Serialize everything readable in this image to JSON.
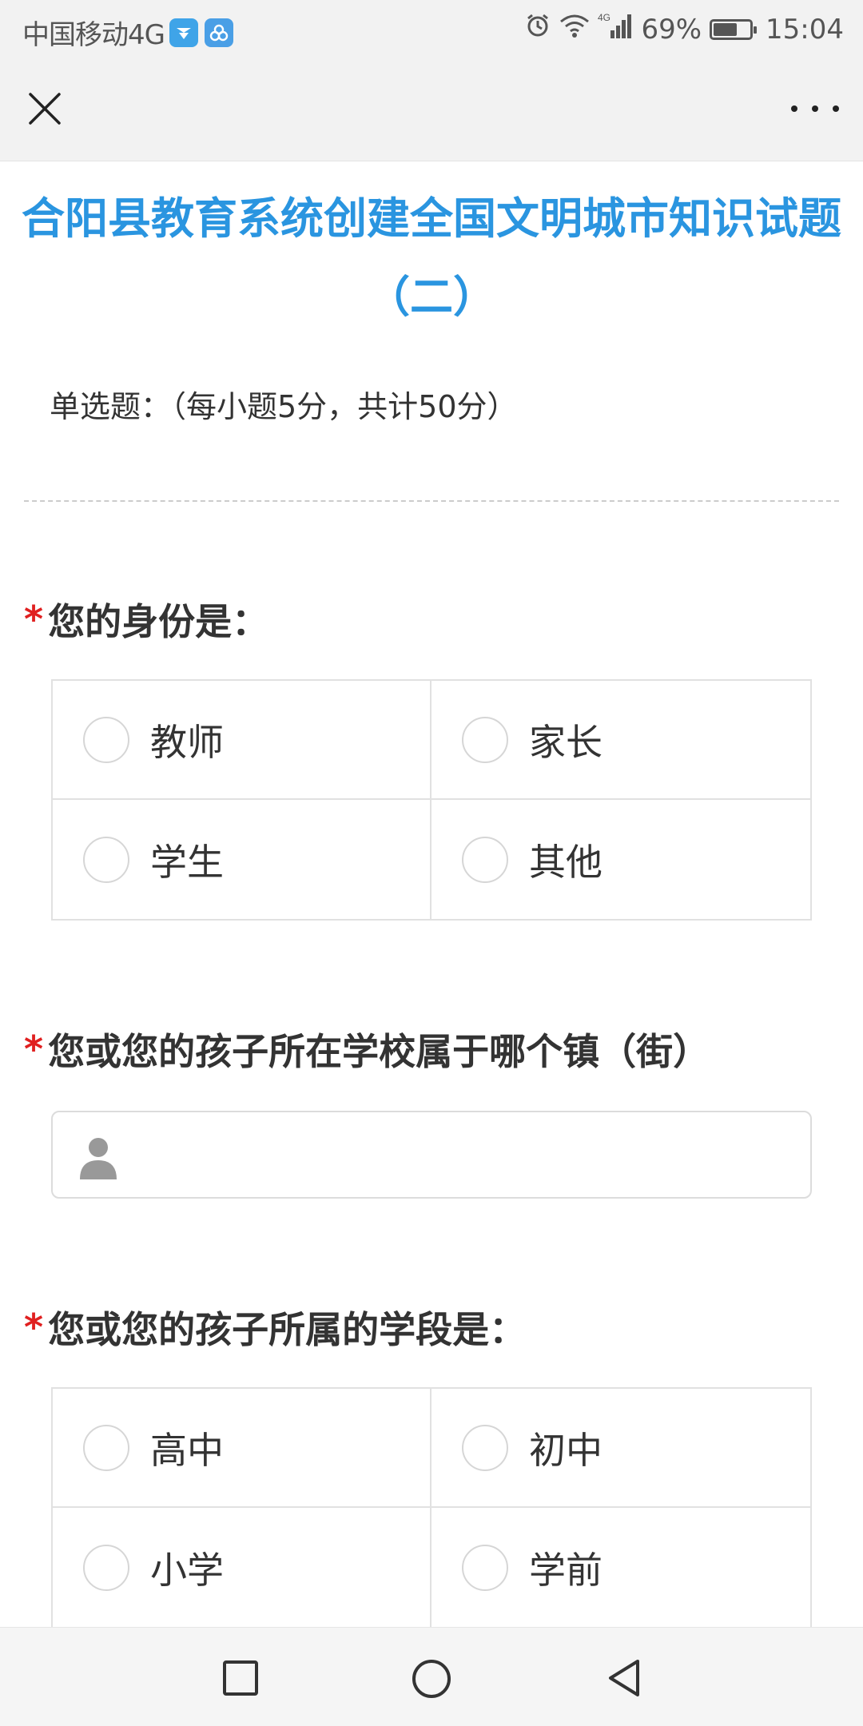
{
  "status_bar": {
    "carrier": "中国移动4G",
    "battery_percent": "69%",
    "battery_level": 0.69,
    "time": "15:04",
    "signal_label": "4G",
    "icons": [
      "app-badge-icon",
      "app-badge-icon",
      "alarm-icon",
      "wifi-icon",
      "signal-icon",
      "battery-icon"
    ]
  },
  "title_bar": {
    "close_icon": "close-icon",
    "more_icon": "more-icon"
  },
  "page": {
    "title": "合阳县教育系统创建全国文明城市知识试题（二）",
    "section_desc": "单选题：（每小题5分，共计50分）"
  },
  "questions": [
    {
      "required_mark": "*",
      "text": "您的身份是：",
      "type": "radio",
      "options": [
        "教师",
        "家长",
        "学生",
        "其他"
      ]
    },
    {
      "required_mark": "*",
      "text": "您或您的孩子所在学校属于哪个镇（街）",
      "type": "text",
      "value": "",
      "icon": "person-icon"
    },
    {
      "required_mark": "*",
      "text": "您或您的孩子所属的学段是：",
      "type": "radio",
      "options": [
        "高中",
        "初中",
        "小学",
        "学前"
      ]
    }
  ],
  "nav_bar": {
    "icons": [
      "recent-apps-icon",
      "home-icon",
      "back-icon"
    ]
  },
  "colors": {
    "title": "#2a95e0",
    "required": "#e02020",
    "text": "#333333",
    "border": "#e1e1e1"
  }
}
